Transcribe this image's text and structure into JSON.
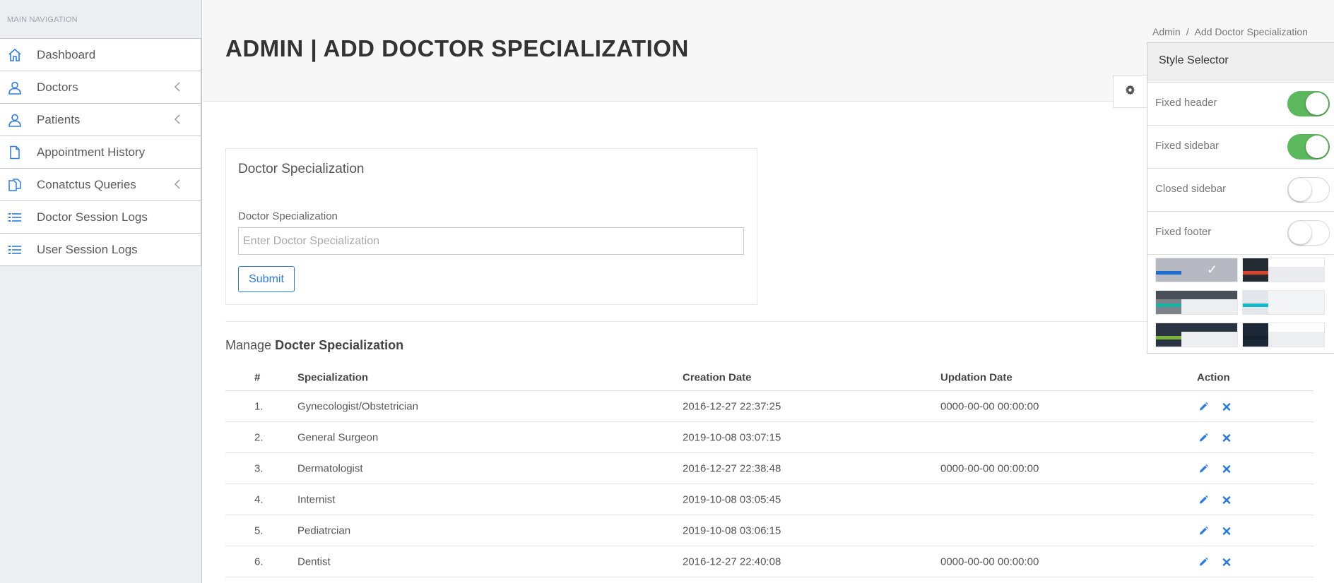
{
  "sidebar": {
    "section_title": "MAIN NAVIGATION",
    "items": [
      {
        "label": "Dashboard",
        "icon": "home-icon",
        "has_children": false
      },
      {
        "label": "Doctors",
        "icon": "user-icon",
        "has_children": true
      },
      {
        "label": "Patients",
        "icon": "user-icon",
        "has_children": true
      },
      {
        "label": "Appointment History",
        "icon": "file-icon",
        "has_children": false
      },
      {
        "label": "Conatctus Queries",
        "icon": "files-icon",
        "has_children": true
      },
      {
        "label": "Doctor Session Logs",
        "icon": "list-icon",
        "has_children": false
      },
      {
        "label": "User Session Logs",
        "icon": "list-icon",
        "has_children": false
      }
    ]
  },
  "header": {
    "title": "ADMIN | ADD DOCTOR SPECIALIZATION",
    "breadcrumb": [
      "Admin",
      "Add Doctor Specialization"
    ]
  },
  "form": {
    "card_title": "Doctor Specialization",
    "field_label": "Doctor Specialization",
    "placeholder": "Enter Doctor Specialization",
    "value": "",
    "submit_label": "Submit"
  },
  "manage": {
    "prefix": "Manage",
    "bold": "Docter Specialization"
  },
  "table": {
    "columns": [
      "#",
      "Specialization",
      "Creation Date",
      "Updation Date",
      "Action"
    ],
    "rows": [
      {
        "num": "1.",
        "spec": "Gynecologist/Obstetrician",
        "created": "2016-12-27 22:37:25",
        "updated": "0000-00-00 00:00:00"
      },
      {
        "num": "2.",
        "spec": "General Surgeon",
        "created": "2019-10-08 03:07:15",
        "updated": ""
      },
      {
        "num": "3.",
        "spec": "Dermatologist",
        "created": "2016-12-27 22:38:48",
        "updated": "0000-00-00 00:00:00"
      },
      {
        "num": "4.",
        "spec": "Internist",
        "created": "2019-10-08 03:05:45",
        "updated": ""
      },
      {
        "num": "5.",
        "spec": "Pediatrcian",
        "created": "2019-10-08 03:06:15",
        "updated": ""
      },
      {
        "num": "6.",
        "spec": "Dentist",
        "created": "2016-12-27 22:40:08",
        "updated": "0000-00-00 00:00:00"
      }
    ]
  },
  "style_selector": {
    "title": "Style Selector",
    "options": [
      {
        "label": "Fixed header",
        "on": true
      },
      {
        "label": "Fixed sidebar",
        "on": true
      },
      {
        "label": "Closed sidebar",
        "on": false
      },
      {
        "label": "Fixed footer",
        "on": false
      }
    ],
    "selected_theme_mark": "✓"
  },
  "colors": {
    "accent": "#2c7be5",
    "toggle_on": "#5cb85c"
  }
}
